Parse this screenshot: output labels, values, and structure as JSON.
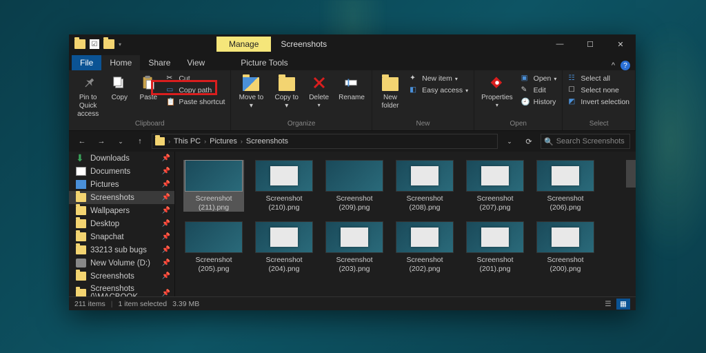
{
  "titlebar": {
    "manage_tab": "Manage",
    "title": "Screenshots"
  },
  "tabs": {
    "file": "File",
    "home": "Home",
    "share": "Share",
    "view": "View",
    "picture_tools": "Picture Tools"
  },
  "ribbon": {
    "clipboard": {
      "label": "Clipboard",
      "pin": "Pin to Quick access",
      "copy": "Copy",
      "paste": "Paste",
      "cut": "Cut",
      "copy_path": "Copy path",
      "paste_shortcut": "Paste shortcut"
    },
    "organize": {
      "label": "Organize",
      "move_to": "Move to",
      "copy_to": "Copy to",
      "delete": "Delete",
      "rename": "Rename"
    },
    "new": {
      "label": "New",
      "new_folder": "New folder",
      "new_item": "New item",
      "easy_access": "Easy access"
    },
    "open": {
      "label": "Open",
      "properties": "Properties",
      "open": "Open",
      "edit": "Edit",
      "history": "History"
    },
    "select": {
      "label": "Select",
      "select_all": "Select all",
      "select_none": "Select none",
      "invert_selection": "Invert selection"
    }
  },
  "address": {
    "segments": [
      "This PC",
      "Pictures",
      "Screenshots"
    ],
    "search_placeholder": "Search Screenshots"
  },
  "nav": {
    "items": [
      {
        "label": "Downloads",
        "icon": "download",
        "pinned": true
      },
      {
        "label": "Documents",
        "icon": "doc",
        "pinned": true
      },
      {
        "label": "Pictures",
        "icon": "pictures",
        "pinned": true
      },
      {
        "label": "Screenshots",
        "icon": "folder",
        "pinned": true,
        "selected": true
      },
      {
        "label": "Wallpapers",
        "icon": "folder",
        "pinned": true
      },
      {
        "label": "Desktop",
        "icon": "folder",
        "pinned": true
      },
      {
        "label": "Snapchat",
        "icon": "folder",
        "pinned": true
      },
      {
        "label": "33213 sub bugs",
        "icon": "folder",
        "pinned": true
      },
      {
        "label": "New Volume (D:)",
        "icon": "drive",
        "pinned": true
      },
      {
        "label": "Screenshots",
        "icon": "folder",
        "pinned": true
      },
      {
        "label": "Screenshots (\\\\MACBOOK",
        "icon": "folder",
        "pinned": true
      }
    ]
  },
  "files": {
    "row1": [
      {
        "name": "Screenshot (211).png",
        "selected": true
      },
      {
        "name": "Screenshot (210).png"
      },
      {
        "name": "Screenshot (209).png"
      },
      {
        "name": "Screenshot (208).png"
      },
      {
        "name": "Screenshot (207).png"
      },
      {
        "name": "Screenshot (206).png"
      }
    ],
    "row2": [
      {
        "name": "Screenshot (205).png"
      },
      {
        "name": "Screenshot (204).png"
      },
      {
        "name": "Screenshot (203).png"
      },
      {
        "name": "Screenshot (202).png"
      },
      {
        "name": "Screenshot (201).png"
      },
      {
        "name": "Screenshot (200).png"
      }
    ]
  },
  "status": {
    "item_count": "211 items",
    "selection": "1 item selected",
    "size": "3.39 MB"
  }
}
